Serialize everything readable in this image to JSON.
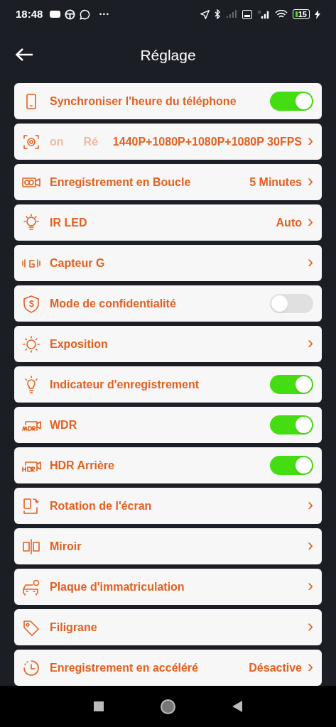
{
  "status_bar": {
    "time": "18:48",
    "more": "···",
    "battery": "15"
  },
  "header": {
    "title": "Réglage"
  },
  "rows": [
    {
      "kind": "toggle",
      "label": "Synchroniser l'heure du téléphone",
      "on": true
    },
    {
      "kind": "marquee",
      "label_parts": [
        "on",
        "Ré"
      ],
      "value": "1440P+1080P+1080P+1080P 30FPS",
      "chevron": "›"
    },
    {
      "kind": "nav",
      "label": "Enregistrement en Boucle",
      "value": "5 Minutes",
      "chevron": "›"
    },
    {
      "kind": "nav",
      "label": "IR LED",
      "value": "Auto",
      "chevron": "›"
    },
    {
      "kind": "nav",
      "label": "Capteur G",
      "chevron": "›"
    },
    {
      "kind": "toggle",
      "label": "Mode de confidentialité",
      "on": false
    },
    {
      "kind": "nav",
      "label": "Exposition",
      "chevron": "›"
    },
    {
      "kind": "toggle",
      "label": "Indicateur d'enregistrement",
      "on": true
    },
    {
      "kind": "toggle",
      "label": "WDR",
      "on": true
    },
    {
      "kind": "toggle",
      "label": "HDR Arrière",
      "on": true
    },
    {
      "kind": "nav",
      "label": "Rotation de l'écran",
      "chevron": "›"
    },
    {
      "kind": "nav",
      "label": "Miroir",
      "chevron": "›"
    },
    {
      "kind": "nav",
      "label": "Plaque d'immatriculation",
      "chevron": "›"
    },
    {
      "kind": "nav",
      "label": "Filigrane",
      "chevron": "›"
    },
    {
      "kind": "nav",
      "label": "Enregistrement en accéléré",
      "value": "Désactive",
      "chevron": "›"
    }
  ]
}
